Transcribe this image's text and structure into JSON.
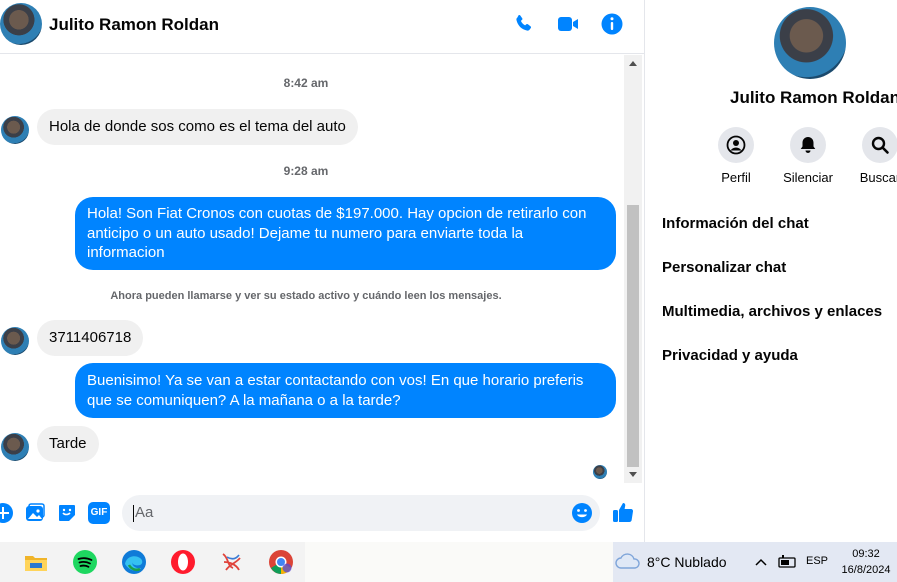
{
  "header": {
    "contact_name": "Julito Ramon Roldan",
    "icons": [
      "phone-icon",
      "video-camera-icon",
      "info-icon"
    ],
    "accent_color": "#0084ff"
  },
  "messages": {
    "ts1": "8:42 am",
    "m1": "Hola de donde sos como es el tema del auto",
    "ts2": "9:28 am",
    "m2": "Hola! Son Fiat Cronos con cuotas de $197.000. Hay opcion de retirarlo con anticipo o un auto usado! Dejame tu numero para enviarte toda la informacion",
    "notice": "Ahora pueden llamarse y ver su estado activo y cuándo leen los mensajes.",
    "m3": "3711406718",
    "m4": "Buenisimo! Ya se van a estar contactando con vos! En que horario preferis que se comuniquen? A la mañana o a la tarde?",
    "m5": "Tarde"
  },
  "composer": {
    "placeholder": "Aa",
    "icons": [
      "plus-icon",
      "image-icon",
      "sticker-icon",
      "gif-icon",
      "emoji-icon",
      "thumbs-up-icon"
    ],
    "gif_label": "GIF"
  },
  "sidebar": {
    "name": "Julito Ramon Roldan",
    "actions": [
      {
        "label": "Perfil",
        "icon": "profile-icon"
      },
      {
        "label": "Silenciar",
        "icon": "bell-icon"
      },
      {
        "label": "Buscar",
        "icon": "search-icon"
      }
    ],
    "menu": [
      "Información del chat",
      "Personalizar chat",
      "Multimedia, archivos y enlaces",
      "Privacidad y ayuda"
    ]
  },
  "taskbar": {
    "apps": [
      "file-explorer-icon",
      "spotify-icon",
      "edge-icon",
      "opera-icon",
      "app-icon",
      "chrome-icon"
    ],
    "weather": "8°C  Nublado",
    "lang": "ESP",
    "time": "09:32",
    "date": "16/8/2024"
  }
}
